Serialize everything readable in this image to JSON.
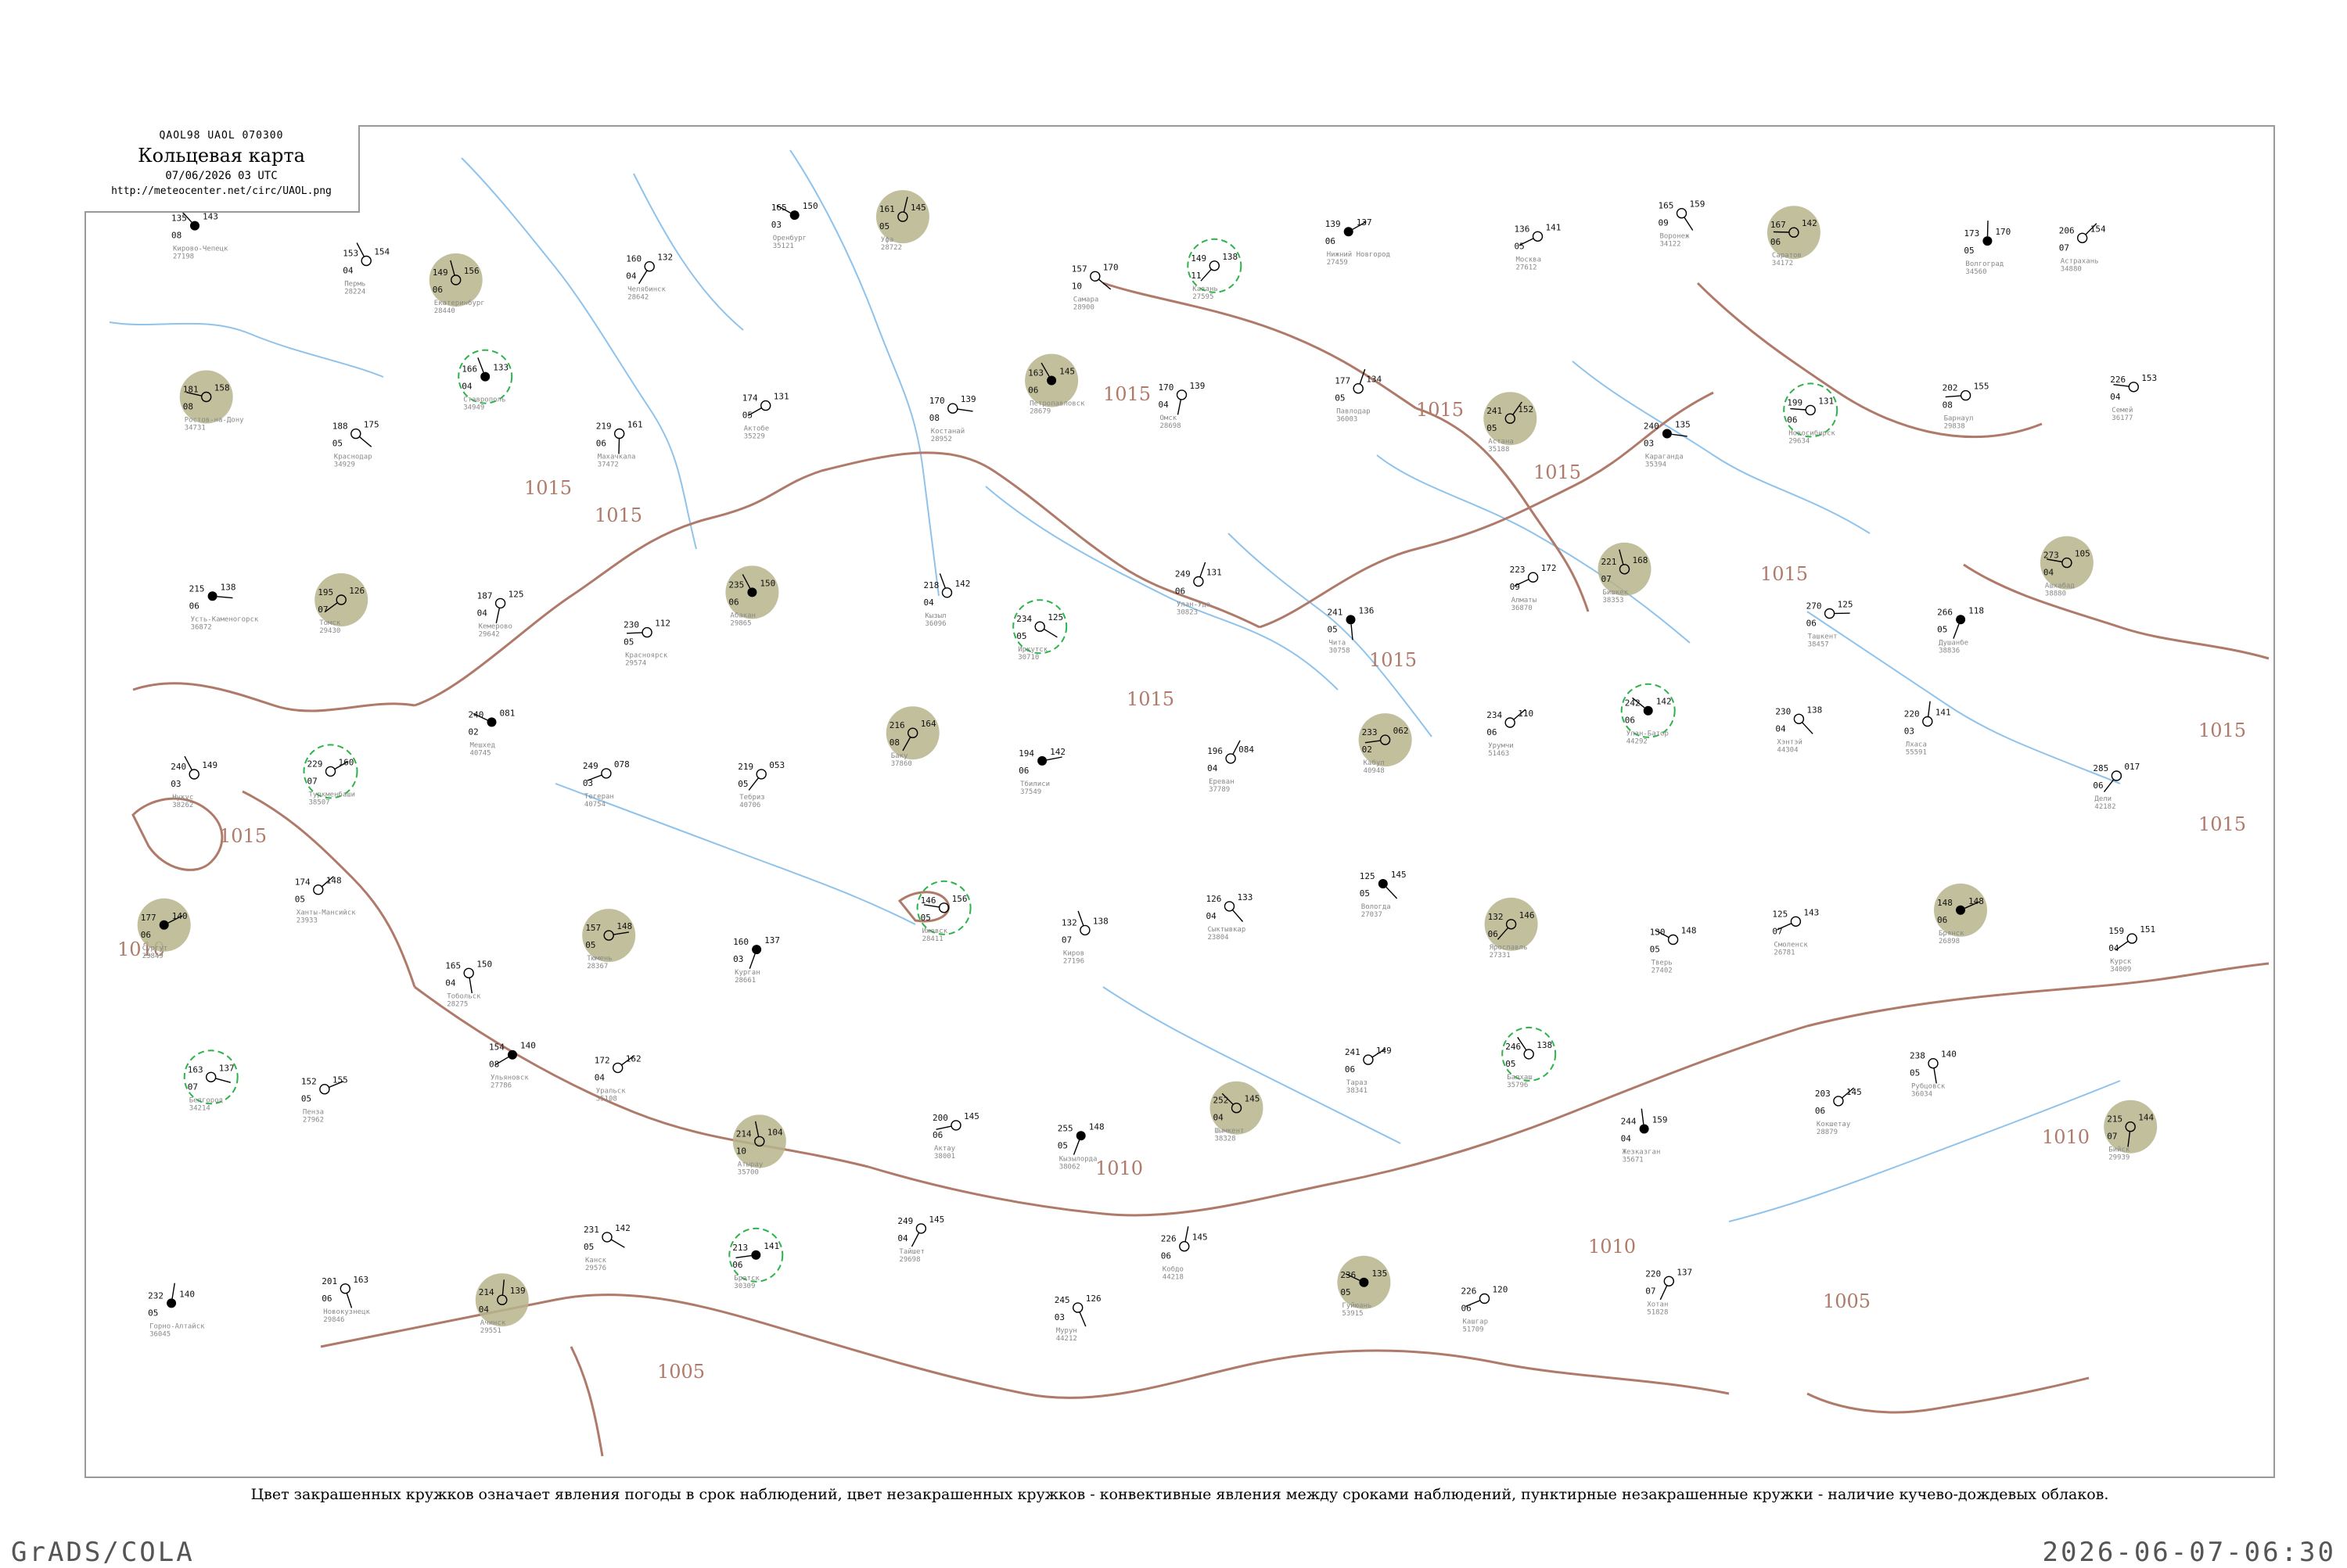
{
  "header": {
    "code": "QAOL98 UAOL 070300",
    "title": "Кольцевая карта",
    "datetime": "07/06/2026 03 UTC",
    "url": "http://meteocenter.net/circ/UAOL.png"
  },
  "isobar_labels": [
    "1015",
    "1015",
    "1015",
    "1015",
    "1015",
    "1015",
    "1015",
    "1015",
    "1015",
    "1015",
    "1015",
    "1010",
    "1010",
    "1010",
    "1010",
    "1005",
    "1005"
  ],
  "caption": "Цвет закрашенных кружков означает явления погоды в срок наблюдений, цвет незакрашенных кружков - конвективные явления между сроками наблюдений, пунктирные незакрашенные кружки - наличие кучево-дождевых облаков.",
  "footer": {
    "left": "GrADS/COLA",
    "right": "2026-06-07-06:30"
  },
  "colors": {
    "isobar": "#b07a6a",
    "river": "#8fc3ec",
    "shower_fill": "#12b82a",
    "fog_fill": "#f5f520",
    "dust_fill": "#b7b48c",
    "cb_ring": "#2db34a"
  },
  "stations": [
    {
      "name": "Кирово-Чепецк",
      "id": "27198",
      "t": "135",
      "td": "08",
      "p": "143"
    },
    {
      "name": "Пермь",
      "id": "28224",
      "t": "153",
      "td": "04",
      "p": "154"
    },
    {
      "name": "Екатеринбург",
      "id": "28440",
      "t": "149",
      "td": "06",
      "p": "156"
    },
    {
      "name": "Челябинск",
      "id": "28642",
      "t": "160",
      "td": "04",
      "p": "132"
    },
    {
      "name": "Оренбург",
      "id": "35121",
      "t": "165",
      "td": "03",
      "p": "150"
    },
    {
      "name": "Уфа",
      "id": "28722",
      "t": "161",
      "td": "05",
      "p": "145"
    },
    {
      "name": "Самара",
      "id": "28900",
      "t": "157",
      "td": "10",
      "p": "170"
    },
    {
      "name": "Казань",
      "id": "27595",
      "t": "149",
      "td": "11",
      "p": "138"
    },
    {
      "name": "Нижний Новгород",
      "id": "27459",
      "t": "139",
      "td": "06",
      "p": "137"
    },
    {
      "name": "Москва",
      "id": "27612",
      "t": "136",
      "td": "05",
      "p": "141"
    },
    {
      "name": "Воронеж",
      "id": "34122",
      "t": "165",
      "td": "09",
      "p": "159"
    },
    {
      "name": "Саратов",
      "id": "34172",
      "t": "167",
      "td": "06",
      "p": "142"
    },
    {
      "name": "Волгоград",
      "id": "34560",
      "t": "173",
      "td": "05",
      "p": "170"
    },
    {
      "name": "Астрахань",
      "id": "34880",
      "t": "206",
      "td": "07",
      "p": "154"
    },
    {
      "name": "Ростов-на-Дону",
      "id": "34731",
      "t": "181",
      "td": "08",
      "p": "158"
    },
    {
      "name": "Краснодар",
      "id": "34929",
      "t": "188",
      "td": "05",
      "p": "175"
    },
    {
      "name": "Ставрополь",
      "id": "34949",
      "t": "166",
      "td": "04",
      "p": "133"
    },
    {
      "name": "Махачкала",
      "id": "37472",
      "t": "219",
      "td": "06",
      "p": "161"
    },
    {
      "name": "Актобе",
      "id": "35229",
      "t": "174",
      "td": "05",
      "p": "131"
    },
    {
      "name": "Костанай",
      "id": "28952",
      "t": "170",
      "td": "08",
      "p": "139"
    },
    {
      "name": "Петропавловск",
      "id": "28679",
      "t": "163",
      "td": "06",
      "p": "145"
    },
    {
      "name": "Омск",
      "id": "28698",
      "t": "170",
      "td": "04",
      "p": "139"
    },
    {
      "name": "Павлодар",
      "id": "36003",
      "t": "177",
      "td": "05",
      "p": "134"
    },
    {
      "name": "Астана",
      "id": "35188",
      "t": "241",
      "td": "05",
      "p": "152"
    },
    {
      "name": "Караганда",
      "id": "35394",
      "t": "240",
      "td": "03",
      "p": "135"
    },
    {
      "name": "Новосибирск",
      "id": "29634",
      "t": "199",
      "td": "06",
      "p": "131"
    },
    {
      "name": "Барнаул",
      "id": "29838",
      "t": "202",
      "td": "08",
      "p": "155"
    },
    {
      "name": "Семей",
      "id": "36177",
      "t": "226",
      "td": "04",
      "p": "153"
    },
    {
      "name": "Усть-Каменогорск",
      "id": "36872",
      "t": "215",
      "td": "06",
      "p": "138"
    },
    {
      "name": "Томск",
      "id": "29430",
      "t": "195",
      "td": "07",
      "p": "126"
    },
    {
      "name": "Кемерово",
      "id": "29642",
      "t": "187",
      "td": "04",
      "p": "125"
    },
    {
      "name": "Красноярск",
      "id": "29574",
      "t": "230",
      "td": "05",
      "p": "112"
    },
    {
      "name": "Абакан",
      "id": "29865",
      "t": "235",
      "td": "06",
      "p": "150"
    },
    {
      "name": "Кызыл",
      "id": "36096",
      "t": "218",
      "td": "04",
      "p": "142"
    },
    {
      "name": "Иркутск",
      "id": "30710",
      "t": "234",
      "td": "05",
      "p": "125"
    },
    {
      "name": "Улан-Удэ",
      "id": "30823",
      "t": "249",
      "td": "06",
      "p": "131"
    },
    {
      "name": "Чита",
      "id": "30758",
      "t": "241",
      "td": "05",
      "p": "136"
    },
    {
      "name": "Алматы",
      "id": "36870",
      "t": "223",
      "td": "09",
      "p": "172"
    },
    {
      "name": "Бишкек",
      "id": "38353",
      "t": "221",
      "td": "07",
      "p": "168"
    },
    {
      "name": "Ташкент",
      "id": "38457",
      "t": "270",
      "td": "06",
      "p": "125"
    },
    {
      "name": "Душанбе",
      "id": "38836",
      "t": "266",
      "td": "05",
      "p": "118"
    },
    {
      "name": "Ашхабад",
      "id": "38880",
      "t": "273",
      "td": "04",
      "p": "105"
    },
    {
      "name": "Нукус",
      "id": "38262",
      "t": "240",
      "td": "03",
      "p": "149"
    },
    {
      "name": "Туркменбаши",
      "id": "38507",
      "t": "229",
      "td": "07",
      "p": "160"
    },
    {
      "name": "Мешхед",
      "id": "40745",
      "t": "240",
      "td": "02",
      "p": "081"
    },
    {
      "name": "Тегеран",
      "id": "40754",
      "t": "249",
      "td": "03",
      "p": "078"
    },
    {
      "name": "Тебриз",
      "id": "40706",
      "t": "219",
      "td": "05",
      "p": "053"
    },
    {
      "name": "Баку",
      "id": "37860",
      "t": "216",
      "td": "08",
      "p": "164"
    },
    {
      "name": "Тбилиси",
      "id": "37549",
      "t": "194",
      "td": "06",
      "p": "142"
    },
    {
      "name": "Ереван",
      "id": "37789",
      "t": "196",
      "td": "04",
      "p": "084"
    },
    {
      "name": "Кабул",
      "id": "40948",
      "t": "233",
      "td": "02",
      "p": "062"
    },
    {
      "name": "Урумчи",
      "id": "51463",
      "t": "234",
      "td": "06",
      "p": "110"
    },
    {
      "name": "Улан-Батор",
      "id": "44292",
      "t": "242",
      "td": "06",
      "p": "142"
    },
    {
      "name": "Хэнтэй",
      "id": "44304",
      "t": "230",
      "td": "04",
      "p": "138"
    },
    {
      "name": "Лхаса",
      "id": "55591",
      "t": "220",
      "td": "03",
      "p": "141"
    },
    {
      "name": "Дели",
      "id": "42182",
      "t": "285",
      "td": "06",
      "p": "017"
    },
    {
      "name": "Сургут",
      "id": "23849",
      "t": "177",
      "td": "06",
      "p": "140"
    },
    {
      "name": "Ханты-Мансийск",
      "id": "23933",
      "t": "174",
      "td": "05",
      "p": "148"
    },
    {
      "name": "Тобольск",
      "id": "28275",
      "t": "165",
      "td": "04",
      "p": "150"
    },
    {
      "name": "Тюмень",
      "id": "28367",
      "t": "157",
      "td": "05",
      "p": "148"
    },
    {
      "name": "Курган",
      "id": "28661",
      "t": "160",
      "td": "03",
      "p": "137"
    },
    {
      "name": "Ижевск",
      "id": "28411",
      "t": "146",
      "td": "05",
      "p": "156"
    },
    {
      "name": "Киров",
      "id": "27196",
      "t": "132",
      "td": "07",
      "p": "138"
    },
    {
      "name": "Сыктывкар",
      "id": "23804",
      "t": "126",
      "td": "04",
      "p": "133"
    },
    {
      "name": "Вологда",
      "id": "27037",
      "t": "125",
      "td": "05",
      "p": "145"
    },
    {
      "name": "Ярославль",
      "id": "27331",
      "t": "132",
      "td": "06",
      "p": "146"
    },
    {
      "name": "Тверь",
      "id": "27402",
      "t": "130",
      "td": "05",
      "p": "148"
    },
    {
      "name": "Смоленск",
      "id": "26781",
      "t": "125",
      "td": "07",
      "p": "143"
    },
    {
      "name": "Брянск",
      "id": "26898",
      "t": "148",
      "td": "06",
      "p": "148"
    },
    {
      "name": "Курск",
      "id": "34009",
      "t": "159",
      "td": "04",
      "p": "151"
    },
    {
      "name": "Белгород",
      "id": "34214",
      "t": "163",
      "td": "07",
      "p": "137"
    },
    {
      "name": "Пенза",
      "id": "27962",
      "t": "152",
      "td": "05",
      "p": "155"
    },
    {
      "name": "Ульяновск",
      "id": "27786",
      "t": "154",
      "td": "08",
      "p": "140"
    },
    {
      "name": "Уральск",
      "id": "35108",
      "t": "172",
      "td": "04",
      "p": "162"
    },
    {
      "name": "Атырау",
      "id": "35700",
      "t": "214",
      "td": "10",
      "p": "104"
    },
    {
      "name": "Актау",
      "id": "38001",
      "t": "200",
      "td": "06",
      "p": "145"
    },
    {
      "name": "Кызылорда",
      "id": "38062",
      "t": "255",
      "td": "05",
      "p": "148"
    },
    {
      "name": "Шымкент",
      "id": "38328",
      "t": "252",
      "td": "04",
      "p": "145"
    },
    {
      "name": "Тараз",
      "id": "38341",
      "t": "241",
      "td": "06",
      "p": "149"
    },
    {
      "name": "Балхаш",
      "id": "35796",
      "t": "246",
      "td": "05",
      "p": "138"
    },
    {
      "name": "Жезказган",
      "id": "35671",
      "t": "244",
      "td": "04",
      "p": "159"
    },
    {
      "name": "Кокшетау",
      "id": "28879",
      "t": "203",
      "td": "06",
      "p": "145"
    },
    {
      "name": "Рубцовск",
      "id": "36034",
      "t": "238",
      "td": "05",
      "p": "140"
    },
    {
      "name": "Бийск",
      "id": "29939",
      "t": "215",
      "td": "07",
      "p": "144"
    },
    {
      "name": "Горно-Алтайск",
      "id": "36045",
      "t": "232",
      "td": "05",
      "p": "140"
    },
    {
      "name": "Новокузнецк",
      "id": "29846",
      "t": "201",
      "td": "06",
      "p": "163"
    },
    {
      "name": "Ачинск",
      "id": "29551",
      "t": "214",
      "td": "04",
      "p": "139"
    },
    {
      "name": "Канск",
      "id": "29576",
      "t": "231",
      "td": "05",
      "p": "142"
    },
    {
      "name": "Братск",
      "id": "30309",
      "t": "213",
      "td": "06",
      "p": "141"
    },
    {
      "name": "Тайшет",
      "id": "29698",
      "t": "249",
      "td": "04",
      "p": "145"
    },
    {
      "name": "Мурун",
      "id": "44212",
      "t": "245",
      "td": "03",
      "p": "126"
    },
    {
      "name": "Кобдо",
      "id": "44218",
      "t": "226",
      "td": "06",
      "p": "145"
    },
    {
      "name": "Гуйюань",
      "id": "53915",
      "t": "236",
      "td": "05",
      "p": "135"
    },
    {
      "name": "Кашгар",
      "id": "51709",
      "t": "226",
      "td": "06",
      "p": "120"
    },
    {
      "name": "Хотан",
      "id": "51828",
      "t": "220",
      "td": "07",
      "p": "137"
    }
  ]
}
